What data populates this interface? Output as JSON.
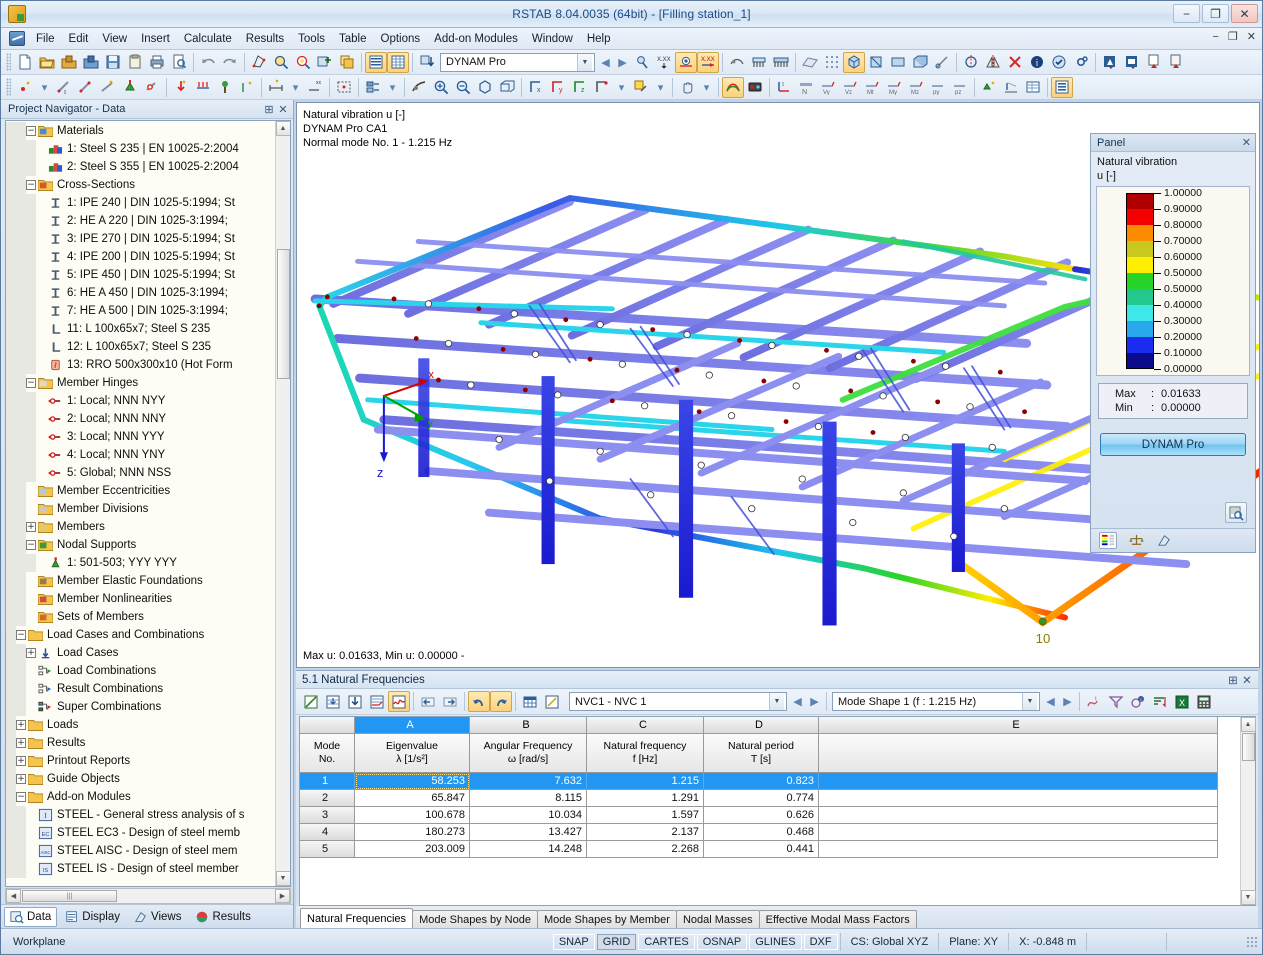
{
  "window": {
    "title": "RSTAB 8.04.0035 (64bit) - [Filling station_1]",
    "minimize": "−",
    "maximize": "❐",
    "close": "✕"
  },
  "menu": {
    "items": [
      "File",
      "Edit",
      "View",
      "Insert",
      "Calculate",
      "Results",
      "Tools",
      "Table",
      "Options",
      "Add-on Modules",
      "Window",
      "Help"
    ],
    "mdi": [
      "−",
      "❐",
      "✕"
    ]
  },
  "toolbar1": {
    "module_combo": "DYNAM Pro"
  },
  "navigator": {
    "title": "Project Navigator - Data",
    "pin": "⊞",
    "close": "✕",
    "tree": [
      {
        "depth": 2,
        "toggle": "−",
        "icon": "folder-materials",
        "label": "Materials"
      },
      {
        "depth": 3,
        "toggle": "",
        "icon": "material",
        "label": "1: Steel S 235 | EN 10025-2:2004"
      },
      {
        "depth": 3,
        "toggle": "",
        "icon": "material",
        "label": "2: Steel S 355 | EN 10025-2:2004"
      },
      {
        "depth": 2,
        "toggle": "−",
        "icon": "folder-sections",
        "label": "Cross-Sections"
      },
      {
        "depth": 3,
        "toggle": "",
        "icon": "i-section",
        "label": "1: IPE 240 | DIN 1025-5:1994; St"
      },
      {
        "depth": 3,
        "toggle": "",
        "icon": "i-section",
        "label": "2: HE A 220 | DIN 1025-3:1994;"
      },
      {
        "depth": 3,
        "toggle": "",
        "icon": "i-section",
        "label": "3: IPE 270 | DIN 1025-5:1994; St"
      },
      {
        "depth": 3,
        "toggle": "",
        "icon": "i-section",
        "label": "4: IPE 200 | DIN 1025-5:1994; St"
      },
      {
        "depth": 3,
        "toggle": "",
        "icon": "i-section",
        "label": "5: IPE 450 | DIN 1025-5:1994; St"
      },
      {
        "depth": 3,
        "toggle": "",
        "icon": "i-section",
        "label": "6: HE A 450 | DIN 1025-3:1994;"
      },
      {
        "depth": 3,
        "toggle": "",
        "icon": "i-section",
        "label": "7: HE A 500 | DIN 1025-3:1994;"
      },
      {
        "depth": 3,
        "toggle": "",
        "icon": "l-section",
        "label": "11: L 100x65x7; Steel S 235"
      },
      {
        "depth": 3,
        "toggle": "",
        "icon": "l-section",
        "label": "12: L 100x65x7; Steel S 235"
      },
      {
        "depth": 3,
        "toggle": "",
        "icon": "rro-section",
        "label": "13: RRO 500x300x10 (Hot Form"
      },
      {
        "depth": 2,
        "toggle": "−",
        "icon": "folder-hinges",
        "label": "Member Hinges"
      },
      {
        "depth": 3,
        "toggle": "",
        "icon": "hinge",
        "label": "1: Local; NNN NYY"
      },
      {
        "depth": 3,
        "toggle": "",
        "icon": "hinge",
        "label": "2: Local; NNN NNY"
      },
      {
        "depth": 3,
        "toggle": "",
        "icon": "hinge",
        "label": "3: Local; NNN YYY"
      },
      {
        "depth": 3,
        "toggle": "",
        "icon": "hinge",
        "label": "4: Local; NNN YNY"
      },
      {
        "depth": 3,
        "toggle": "",
        "icon": "hinge",
        "label": "5: Global; NNN NSS"
      },
      {
        "depth": 2,
        "toggle": "",
        "icon": "folder-ecc",
        "label": "Member Eccentricities"
      },
      {
        "depth": 2,
        "toggle": "",
        "icon": "folder-div",
        "label": "Member Divisions"
      },
      {
        "depth": 2,
        "toggle": "+",
        "icon": "folder-members",
        "label": "Members"
      },
      {
        "depth": 2,
        "toggle": "−",
        "icon": "folder-supports",
        "label": "Nodal Supports"
      },
      {
        "depth": 3,
        "toggle": "",
        "icon": "support",
        "label": "1: 501-503; YYY YYY"
      },
      {
        "depth": 2,
        "toggle": "",
        "icon": "folder-found",
        "label": "Member Elastic Foundations"
      },
      {
        "depth": 2,
        "toggle": "",
        "icon": "folder-nonlin",
        "label": "Member Nonlinearities"
      },
      {
        "depth": 2,
        "toggle": "",
        "icon": "folder-sets",
        "label": "Sets of Members"
      },
      {
        "depth": 1,
        "toggle": "−",
        "icon": "folder",
        "label": "Load Cases and Combinations"
      },
      {
        "depth": 2,
        "toggle": "+",
        "icon": "load-case",
        "label": "Load Cases"
      },
      {
        "depth": 2,
        "toggle": "",
        "icon": "load-comb",
        "label": "Load Combinations"
      },
      {
        "depth": 2,
        "toggle": "",
        "icon": "result-comb",
        "label": "Result Combinations"
      },
      {
        "depth": 2,
        "toggle": "",
        "icon": "super-comb",
        "label": "Super Combinations"
      },
      {
        "depth": 1,
        "toggle": "+",
        "icon": "folder",
        "label": "Loads"
      },
      {
        "depth": 1,
        "toggle": "+",
        "icon": "folder",
        "label": "Results"
      },
      {
        "depth": 1,
        "toggle": "+",
        "icon": "folder",
        "label": "Printout Reports"
      },
      {
        "depth": 1,
        "toggle": "+",
        "icon": "folder",
        "label": "Guide Objects"
      },
      {
        "depth": 1,
        "toggle": "−",
        "icon": "folder",
        "label": "Add-on Modules"
      },
      {
        "depth": 2,
        "toggle": "",
        "icon": "mod-steel",
        "label": "STEEL - General stress analysis of s"
      },
      {
        "depth": 2,
        "toggle": "",
        "icon": "mod-ec3",
        "label": "STEEL EC3 - Design of steel memb"
      },
      {
        "depth": 2,
        "toggle": "",
        "icon": "mod-aisc",
        "label": "STEEL AISC - Design of steel mem"
      },
      {
        "depth": 2,
        "toggle": "",
        "icon": "mod-is",
        "label": "STEEL IS - Design of steel member"
      }
    ],
    "tabs": [
      {
        "label": "Data",
        "icon": "data-icon",
        "selected": true
      },
      {
        "label": "Display",
        "icon": "display-icon",
        "selected": false
      },
      {
        "label": "Views",
        "icon": "views-icon",
        "selected": false
      },
      {
        "label": "Results",
        "icon": "results-icon",
        "selected": false
      }
    ]
  },
  "viewport": {
    "caption_line1": "Natural vibration u [-]",
    "caption_line2": "DYNAM Pro CA1",
    "caption_line3": "Normal mode No. 1 - 1.215 Hz",
    "footer": "Max u: 0.01633, Min u: 0.00000 -",
    "axis_x": "x",
    "axis_y": "y",
    "axis_z": "z",
    "node_label": "10"
  },
  "panel": {
    "title": "Panel",
    "close": "✕",
    "label_line1": "Natural vibration",
    "label_line2": "u [-]",
    "legend_values": [
      "1.00000",
      "0.90000",
      "0.80000",
      "0.70000",
      "0.60000",
      "0.50000",
      "0.50000",
      "0.40000",
      "0.30000",
      "0.20000",
      "0.10000",
      "0.00000"
    ],
    "legend_colors": [
      "#b00000",
      "#f40000",
      "#fb8c00",
      "#c8c81e",
      "#ffee00",
      "#27d427",
      "#22c88c",
      "#3fe8e8",
      "#2aa8ee",
      "#1a2cf0",
      "#0b0b8c"
    ],
    "max_key": "Max",
    "max_sep": ":",
    "max_value": "0.01633",
    "min_key": "Min",
    "min_sep": ":",
    "min_value": "0.00000",
    "button": "DYNAM Pro",
    "zoom_icon": "zoom-legend-icon",
    "tabs": [
      "color-scale-tab",
      "scale-factor-tab",
      "display-tab"
    ]
  },
  "dock": {
    "title": "5.1 Natural Frequencies",
    "pin": "⊞",
    "close": "✕",
    "case_combo": "NVC1 - NVC 1",
    "mode_combo": "Mode Shape 1 (f : 1.215 Hz)",
    "tabs": [
      {
        "label": "Natural Frequencies",
        "selected": true
      },
      {
        "label": "Mode Shapes by Node",
        "selected": false
      },
      {
        "label": "Mode Shapes by Member",
        "selected": false
      },
      {
        "label": "Nodal Masses",
        "selected": false
      },
      {
        "label": "Effective Modal Mass Factors",
        "selected": false
      }
    ],
    "table": {
      "col_letters": [
        "A",
        "B",
        "C",
        "D",
        "E"
      ],
      "rowhdr_line1": "Mode",
      "rowhdr_line2": "No.",
      "headers": [
        {
          "name": "Eigenvalue",
          "unit": "λ [1/s²]"
        },
        {
          "name": "Angular Frequency",
          "unit": "ω [rad/s]"
        },
        {
          "name": "Natural frequency",
          "unit": "f [Hz]"
        },
        {
          "name": "Natural period",
          "unit": "T [s]"
        },
        {
          "name": "",
          "unit": ""
        }
      ],
      "rows": [
        {
          "no": "1",
          "cells": [
            "58.253",
            "7.632",
            "1.215",
            "0.823",
            ""
          ],
          "selected": true
        },
        {
          "no": "2",
          "cells": [
            "65.847",
            "8.115",
            "1.291",
            "0.774",
            ""
          ],
          "selected": false
        },
        {
          "no": "3",
          "cells": [
            "100.678",
            "10.034",
            "1.597",
            "0.626",
            ""
          ],
          "selected": false
        },
        {
          "no": "4",
          "cells": [
            "180.273",
            "13.427",
            "2.137",
            "0.468",
            ""
          ],
          "selected": false
        },
        {
          "no": "5",
          "cells": [
            "203.009",
            "14.248",
            "2.268",
            "0.441",
            ""
          ],
          "selected": false
        }
      ]
    }
  },
  "status": {
    "workplane": "Workplane",
    "toggles": [
      {
        "label": "SNAP",
        "down": false
      },
      {
        "label": "GRID",
        "down": true
      },
      {
        "label": "CARTES",
        "down": false
      },
      {
        "label": "OSNAP",
        "down": false
      },
      {
        "label": "GLINES",
        "down": false
      },
      {
        "label": "DXF",
        "down": false
      }
    ],
    "cs": "CS: Global XYZ",
    "plane": "Plane: XY",
    "coord": "X:  -0.848 m"
  }
}
